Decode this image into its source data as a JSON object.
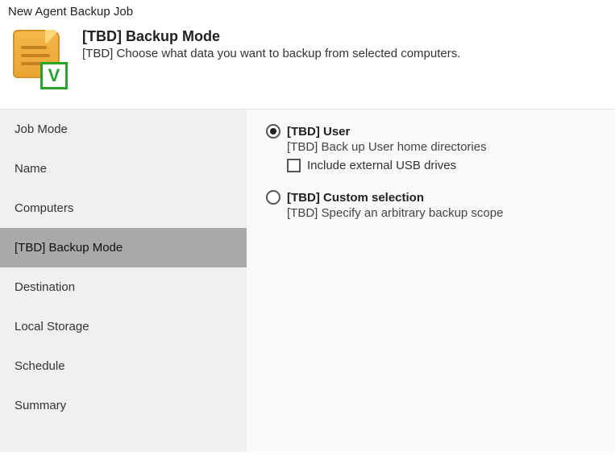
{
  "window": {
    "title": "New Agent Backup Job"
  },
  "header": {
    "title": "[TBD] Backup Mode",
    "subtitle": "[TBD] Choose what data you want to backup from selected computers.",
    "icon_name": "document-icon",
    "badge_letter": "V"
  },
  "sidebar": {
    "items": [
      {
        "label": "Job Mode",
        "selected": false
      },
      {
        "label": "Name",
        "selected": false
      },
      {
        "label": "Computers",
        "selected": false
      },
      {
        "label": "[TBD] Backup Mode",
        "selected": true
      },
      {
        "label": "Destination",
        "selected": false
      },
      {
        "label": "Local Storage",
        "selected": false
      },
      {
        "label": "Schedule",
        "selected": false
      },
      {
        "label": "Summary",
        "selected": false
      }
    ]
  },
  "content": {
    "options": [
      {
        "checked": true,
        "title": "[TBD] User",
        "desc": "[TBD] Back up User home directories",
        "sub": {
          "checked": false,
          "label": "Include external USB drives"
        }
      },
      {
        "checked": false,
        "title": "[TBD] Custom selection",
        "desc": "[TBD] Specify an arbitrary backup scope"
      }
    ]
  }
}
